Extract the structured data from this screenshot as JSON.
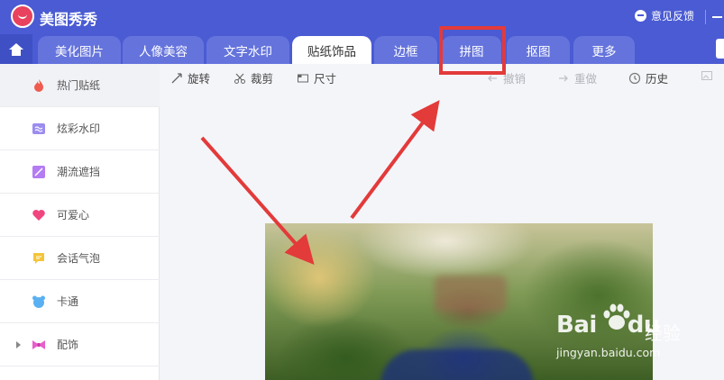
{
  "app": {
    "title": "美图秀秀",
    "feedback": "意见反馈"
  },
  "tabs": [
    {
      "label": "美化图片",
      "active": false
    },
    {
      "label": "人像美容",
      "active": false
    },
    {
      "label": "文字水印",
      "active": false
    },
    {
      "label": "贴纸饰品",
      "active": true
    },
    {
      "label": "边框",
      "active": false
    },
    {
      "label": "拼图",
      "active": false
    },
    {
      "label": "抠图",
      "active": false
    },
    {
      "label": "更多",
      "active": false
    }
  ],
  "sidebar": {
    "items": [
      {
        "label": "热门贴纸",
        "icon": "flame-icon",
        "color": "#ef5b4f",
        "active": true
      },
      {
        "label": "炫彩水印",
        "icon": "watermark-icon",
        "color": "#9b8cf0",
        "active": false
      },
      {
        "label": "潮流遮挡",
        "icon": "mask-icon",
        "color": "#b47cf3",
        "active": false
      },
      {
        "label": "可爱心",
        "icon": "heart-icon",
        "color": "#f0457f",
        "active": false
      },
      {
        "label": "会话气泡",
        "icon": "speech-bubble-icon",
        "color": "#f4c53a",
        "active": false
      },
      {
        "label": "卡通",
        "icon": "bear-icon",
        "color": "#5ab0f0",
        "active": false
      },
      {
        "label": "配饰",
        "icon": "bow-icon",
        "color": "#e85ecb",
        "active": false
      }
    ]
  },
  "toolbar": {
    "rotate": "旋转",
    "crop": "裁剪",
    "size": "尺寸",
    "undo": "撤销",
    "redo": "重做",
    "history": "历史"
  },
  "watermark": {
    "brand": "Bai",
    "brand_tail": "du",
    "cn": "经验",
    "url": "jingyan.baidu.com"
  },
  "colors": {
    "accent": "#4a5bd3",
    "tab": "#6574dc",
    "highlight": "#e33a3a"
  }
}
